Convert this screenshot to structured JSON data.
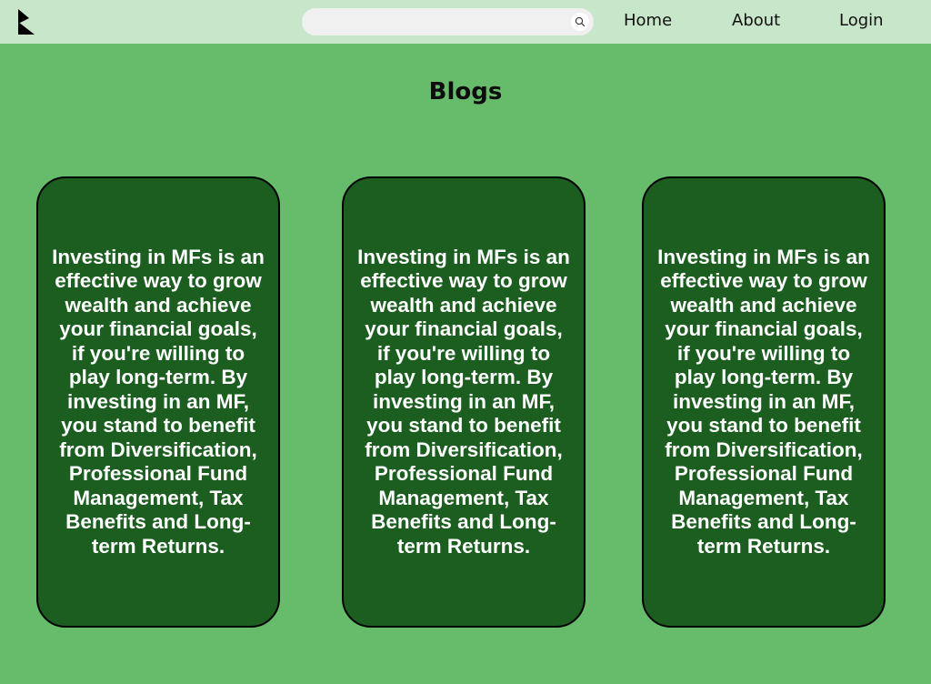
{
  "navbar": {
    "logo_icon": "brand-logo-icon",
    "search": {
      "placeholder": "",
      "value": "",
      "icon": "search-icon"
    },
    "links": [
      {
        "label": "Home"
      },
      {
        "label": "About"
      },
      {
        "label": "Login"
      }
    ],
    "background": "#c8e6c9"
  },
  "page": {
    "title": "Blogs",
    "background": "#66bc6a"
  },
  "cards": [
    {
      "text": "Investing in MFs is an effective way to grow wealth and achieve your financial goals, if you're willing to play long-term. By investing in an MF, you stand to benefit from Diversification, Professional Fund Management, Tax Benefits and Long-term Returns."
    },
    {
      "text": "Investing in MFs is an effective way to grow wealth and achieve your financial goals, if you're willing to play long-term. By investing in an MF, you stand to benefit from Diversification, Professional Fund Management, Tax Benefits and Long-term Returns."
    },
    {
      "text": "Investing in MFs is an effective way to grow wealth and achieve your financial goals, if you're willing to play long-term. By investing in an MF, you stand to benefit from Diversification, Professional Fund Management, Tax Benefits and Long-term Returns."
    }
  ],
  "colors": {
    "card_background": "#1b5e20",
    "card_text": "#ffffff",
    "card_border": "#000000"
  }
}
